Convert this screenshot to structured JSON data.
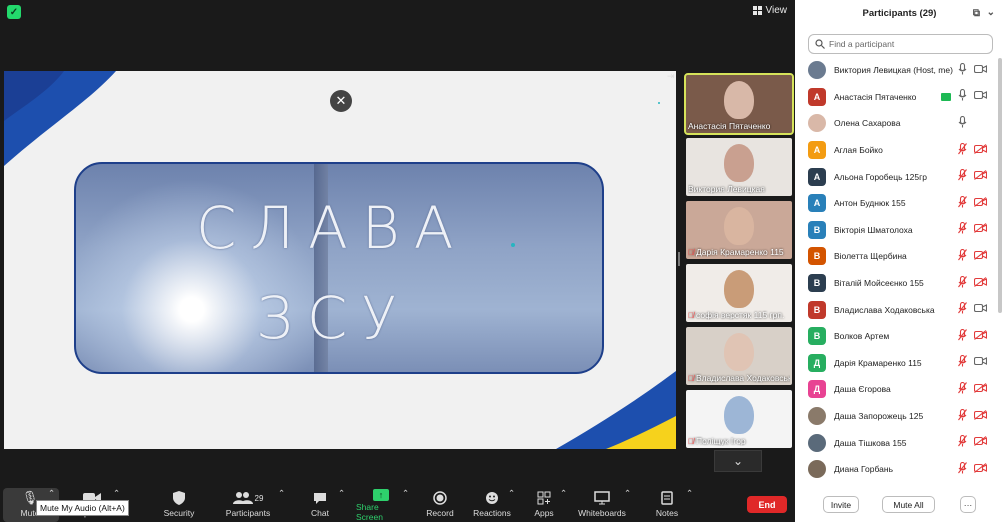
{
  "topbar": {
    "view_label": "View"
  },
  "slide": {
    "line1": "СЛАВА",
    "line2": "ЗСУ"
  },
  "gallery": [
    {
      "name": "Анастасія Пятаченко",
      "muted": false,
      "active": true,
      "skin": "#d8b8a8",
      "bg": "#7a5a4a"
    },
    {
      "name": "Виктория Левицкая",
      "muted": false,
      "active": false,
      "skin": "#c9a090",
      "bg": "#e8e4e0"
    },
    {
      "name": "Дарія Крамаренко 115",
      "muted": true,
      "active": false,
      "skin": "#d9b5a0",
      "bg": "#caa898"
    },
    {
      "name": "софія верстяк 115 грп.",
      "muted": true,
      "active": false,
      "skin": "#c99c78",
      "bg": "#f0ece8"
    },
    {
      "name": "Владислава Ходаковська",
      "muted": true,
      "active": false,
      "skin": "#e0c4b4",
      "bg": "#d8d0c8"
    },
    {
      "name": "Поліщук Ігор",
      "muted": true,
      "active": false,
      "skin": "#9db6d6",
      "bg": "#f4f4f4"
    }
  ],
  "toolbar": {
    "mute": "Mute",
    "stop_video": "Stop Video",
    "security": "Security",
    "participants": "Participants",
    "participants_count": "29",
    "chat": "Chat",
    "share_screen": "Share Screen",
    "record": "Record",
    "reactions": "Reactions",
    "apps": "Apps",
    "whiteboards": "Whiteboards",
    "notes": "Notes",
    "end": "End",
    "tooltip": "Mute My Audio (Alt+A)"
  },
  "panel": {
    "title": "Participants (29)",
    "search_placeholder": "Find a participant",
    "invite": "Invite",
    "mute_all": "Mute All",
    "more": "···",
    "participants": [
      {
        "name": "Виктория Левицкая (Host, me)",
        "initial": "",
        "color": "#6b7b90",
        "mic": "on",
        "video": "on",
        "sharing": false
      },
      {
        "name": "Анастасія Пятаченко",
        "initial": "А",
        "color": "#c0392b",
        "mic": "on",
        "video": "on",
        "sharing": true
      },
      {
        "name": "Олена Сахарова",
        "initial": "",
        "color": "#d9b8a8",
        "mic": "on",
        "video": "none",
        "sharing": false
      },
      {
        "name": "Аглая Бойко",
        "initial": "А",
        "color": "#f39c12",
        "mic": "off",
        "video": "off",
        "sharing": false
      },
      {
        "name": "Альона Горобець 125гр",
        "initial": "А",
        "color": "#2c3e50",
        "mic": "off",
        "video": "off",
        "sharing": false
      },
      {
        "name": "Антон Буднюк 155",
        "initial": "А",
        "color": "#2980b9",
        "mic": "off",
        "video": "off",
        "sharing": false
      },
      {
        "name": "Вікторія Шматолоха",
        "initial": "В",
        "color": "#2980b9",
        "mic": "off",
        "video": "off",
        "sharing": false
      },
      {
        "name": "Віолетта Щербина",
        "initial": "В",
        "color": "#d35400",
        "mic": "off",
        "video": "off",
        "sharing": false
      },
      {
        "name": "Віталій Мойсеєнко 155",
        "initial": "В",
        "color": "#2c3e50",
        "mic": "off",
        "video": "off",
        "sharing": false
      },
      {
        "name": "Владислава Ходаковська",
        "initial": "В",
        "color": "#c0392b",
        "mic": "off",
        "video": "on",
        "sharing": false
      },
      {
        "name": "Волков Артем",
        "initial": "В",
        "color": "#27ae60",
        "mic": "off",
        "video": "off",
        "sharing": false
      },
      {
        "name": "Дарія Крамаренко 115",
        "initial": "Д",
        "color": "#27ae60",
        "mic": "off",
        "video": "on",
        "sharing": false
      },
      {
        "name": "Даша Єгорова",
        "initial": "Д",
        "color": "#e84393",
        "mic": "off",
        "video": "off",
        "sharing": false
      },
      {
        "name": "Даша Запорожець 125",
        "initial": "",
        "color": "#8a7a6a",
        "mic": "off",
        "video": "off",
        "sharing": false
      },
      {
        "name": "Даша Тішкова 155",
        "initial": "",
        "color": "#5a6a7a",
        "mic": "off",
        "video": "off",
        "sharing": false
      },
      {
        "name": "Диана Горбань",
        "initial": "",
        "color": "#7a6a5a",
        "mic": "off",
        "video": "off",
        "sharing": false
      }
    ]
  }
}
